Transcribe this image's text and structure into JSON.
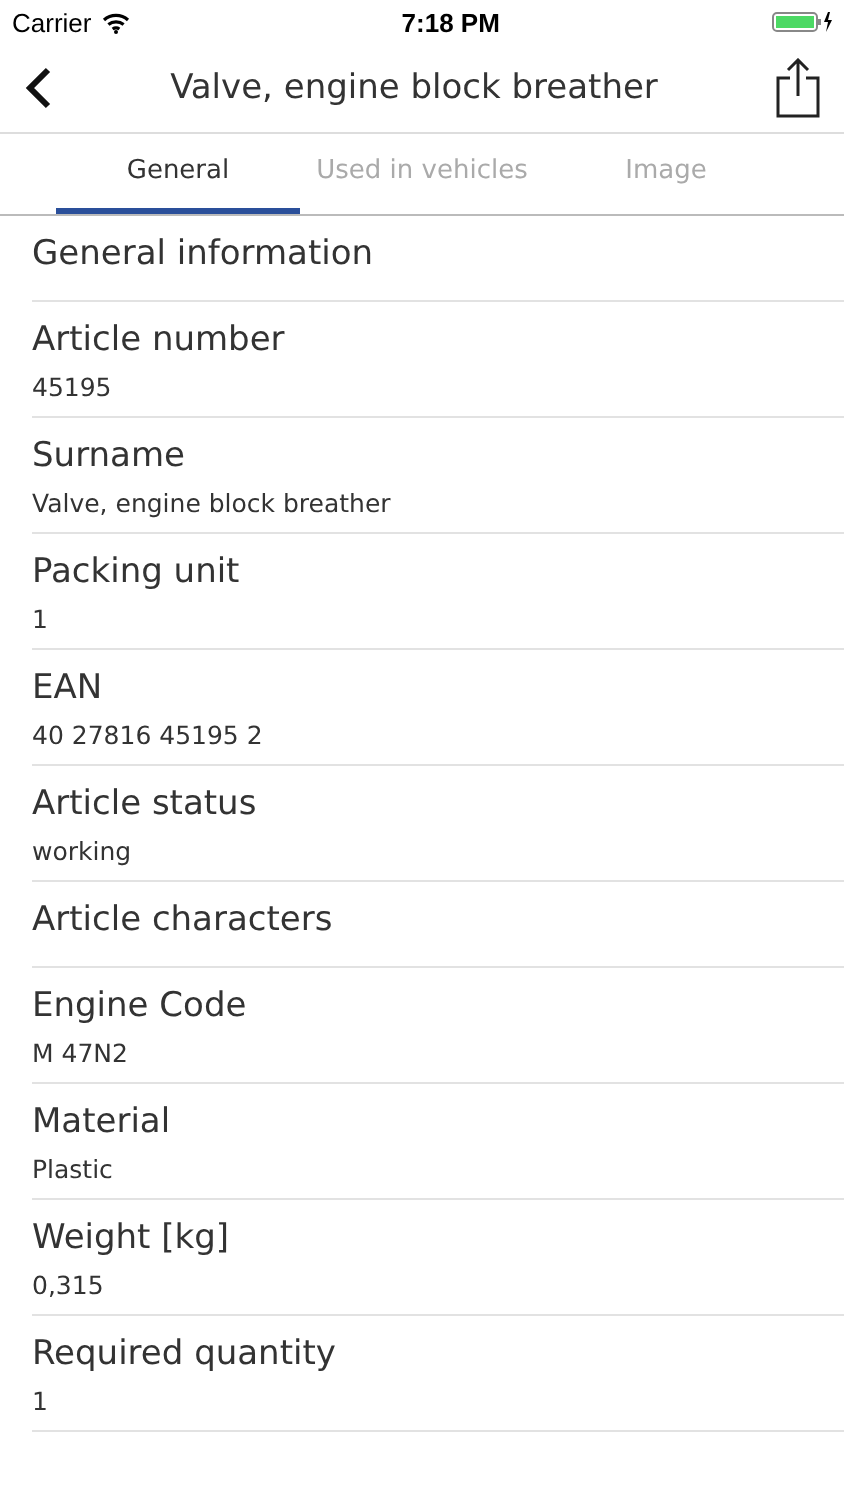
{
  "status_bar": {
    "carrier": "Carrier",
    "time": "7:18 PM"
  },
  "nav": {
    "title": "Valve, engine block breather"
  },
  "tabs": [
    {
      "label": "General",
      "selected": true
    },
    {
      "label": "Used in vehicles",
      "selected": false
    },
    {
      "label": "Image",
      "selected": false
    }
  ],
  "rows": [
    {
      "kind": "header",
      "label": "General information"
    },
    {
      "kind": "field",
      "label": "Article number",
      "value": "45195"
    },
    {
      "kind": "field",
      "label": "Surname",
      "value": "Valve, engine block breather"
    },
    {
      "kind": "field",
      "label": "Packing unit",
      "value": "1"
    },
    {
      "kind": "field",
      "label": "EAN",
      "value": "40 27816 45195 2"
    },
    {
      "kind": "field",
      "label": "Article status",
      "value": "working"
    },
    {
      "kind": "header",
      "label": "Article characters"
    },
    {
      "kind": "field",
      "label": "Engine Code",
      "value": "M 47N2"
    },
    {
      "kind": "field",
      "label": "Material",
      "value": "Plastic"
    },
    {
      "kind": "field",
      "label": "Weight [kg]",
      "value": "0,315"
    },
    {
      "kind": "field",
      "label": "Required quantity",
      "value": "1"
    }
  ]
}
